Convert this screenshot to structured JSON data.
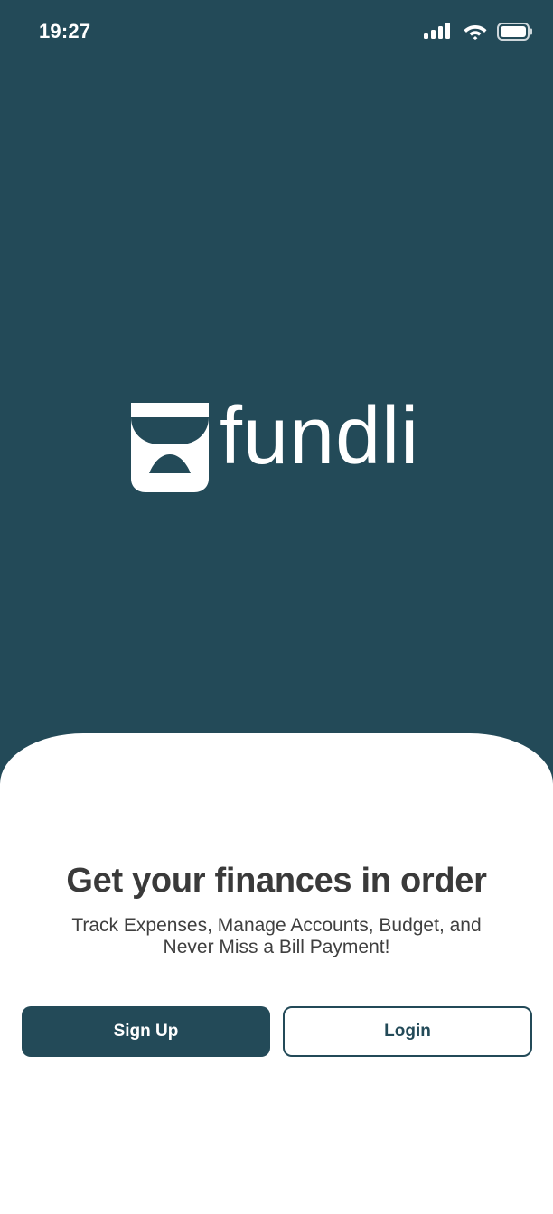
{
  "status_bar": {
    "time": "19:27",
    "icons": [
      "cellular-signal-icon",
      "wifi-icon",
      "battery-icon"
    ]
  },
  "brand": {
    "name": "fundli",
    "logo_icon": "wallet-icon"
  },
  "welcome": {
    "headline": "Get your finances in order",
    "subtitle_line1": "Track Expenses, Manage Accounts, Budget, and",
    "subtitle_line2": "Never Miss a Bill Payment!"
  },
  "actions": {
    "signup_label": "Sign Up",
    "login_label": "Login"
  },
  "colors": {
    "primary": "#234a58",
    "background_sheet": "#ffffff",
    "text_dark": "#3a3a3a"
  }
}
